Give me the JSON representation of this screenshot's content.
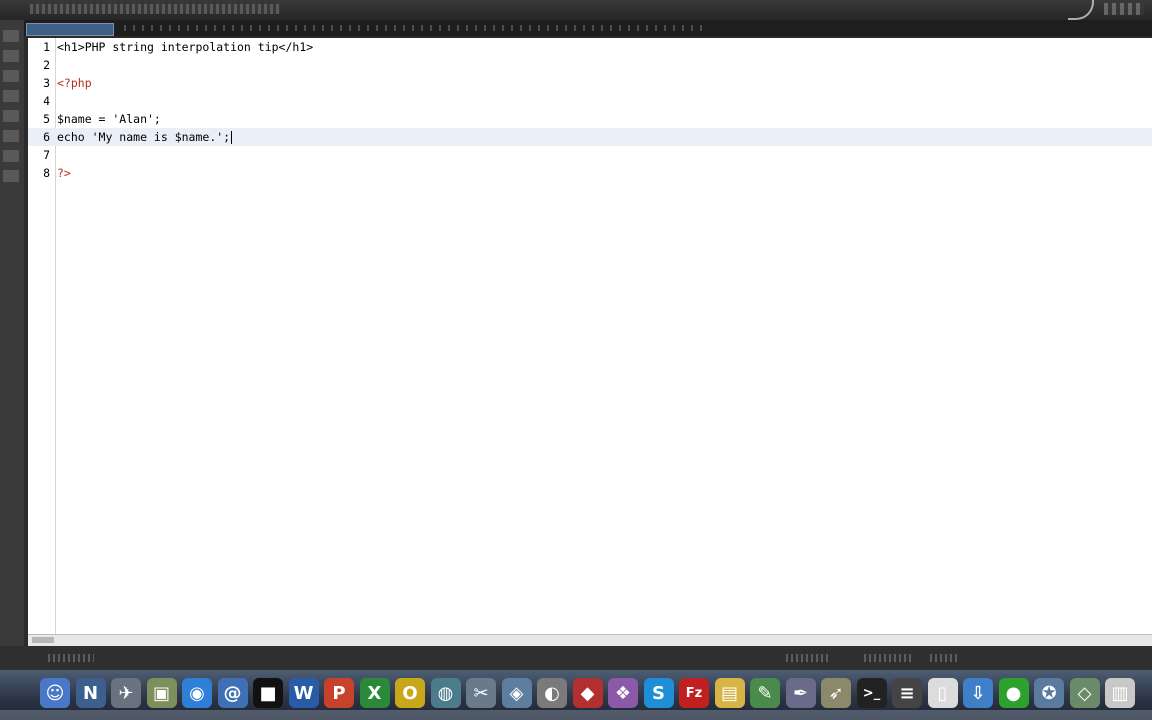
{
  "editor": {
    "lines": [
      {
        "num": "1",
        "text": "<h1>PHP string interpolation tip</h1>"
      },
      {
        "num": "2",
        "text": ""
      },
      {
        "num": "3",
        "text": "<?php"
      },
      {
        "num": "4",
        "text": ""
      },
      {
        "num": "5",
        "text": "$name = 'Alan';"
      },
      {
        "num": "6",
        "text": "echo 'My name is $name.';"
      },
      {
        "num": "7",
        "text": ""
      },
      {
        "num": "8",
        "text": "?>"
      }
    ],
    "current_line": "6"
  },
  "dock": {
    "icons": [
      {
        "name": "finder-icon",
        "glyph": "☺",
        "color": "#4a78c8"
      },
      {
        "name": "app-n-icon",
        "glyph": "N",
        "color": "#3c5f8e"
      },
      {
        "name": "rocket-icon",
        "glyph": "✈",
        "color": "#6a7280"
      },
      {
        "name": "photo-icon",
        "glyph": "▣",
        "color": "#7d8f5c"
      },
      {
        "name": "browser-globe-icon",
        "glyph": "◉",
        "color": "#2f7fd6"
      },
      {
        "name": "mail-icon",
        "glyph": "@",
        "color": "#3f6fb4"
      },
      {
        "name": "terminal-black-icon",
        "glyph": "■",
        "color": "#111111"
      },
      {
        "name": "word-icon",
        "glyph": "W",
        "color": "#2a5ba8"
      },
      {
        "name": "powerpoint-icon",
        "glyph": "P",
        "color": "#c8412a"
      },
      {
        "name": "excel-icon",
        "glyph": "X",
        "color": "#2a8a3a"
      },
      {
        "name": "ring-icon",
        "glyph": "O",
        "color": "#c8a81a"
      },
      {
        "name": "globe-icon",
        "glyph": "◍",
        "color": "#4c7c8c"
      },
      {
        "name": "tools-icon",
        "glyph": "✂",
        "color": "#6a7a8a"
      },
      {
        "name": "network-icon",
        "glyph": "◈",
        "color": "#5e7ea0"
      },
      {
        "name": "safe-icon",
        "glyph": "◐",
        "color": "#7a7a7a"
      },
      {
        "name": "red-box-icon",
        "glyph": "◆",
        "color": "#b23030"
      },
      {
        "name": "purple-app-icon",
        "glyph": "❖",
        "color": "#8a5aa8"
      },
      {
        "name": "skype-icon",
        "glyph": "S",
        "color": "#1e8fd6"
      },
      {
        "name": "filezilla-icon",
        "glyph": "Fz",
        "color": "#c02020"
      },
      {
        "name": "folder-icon",
        "glyph": "▤",
        "color": "#d6b446"
      },
      {
        "name": "script-icon",
        "glyph": "✎",
        "color": "#4a8a4a"
      },
      {
        "name": "pen-icon",
        "glyph": "✒",
        "color": "#6a6a8a"
      },
      {
        "name": "feather-icon",
        "glyph": "➶",
        "color": "#8a8a6a"
      },
      {
        "name": "terminal-icon",
        "glyph": ">_",
        "color": "#222222"
      },
      {
        "name": "console-icon",
        "glyph": "≡",
        "color": "#444444"
      },
      {
        "name": "document-icon",
        "glyph": "▯",
        "color": "#dcdcdc"
      },
      {
        "name": "downloads-icon",
        "glyph": "⇩",
        "color": "#3f7fc8"
      },
      {
        "name": "green-globe-icon",
        "glyph": "●",
        "color": "#2ea02e"
      },
      {
        "name": "gear-globe-icon",
        "glyph": "✪",
        "color": "#5a7aa0"
      },
      {
        "name": "cube-icon",
        "glyph": "◇",
        "color": "#6a8a6a"
      },
      {
        "name": "trash-icon",
        "glyph": "▥",
        "color": "#c8c8c8"
      }
    ]
  }
}
